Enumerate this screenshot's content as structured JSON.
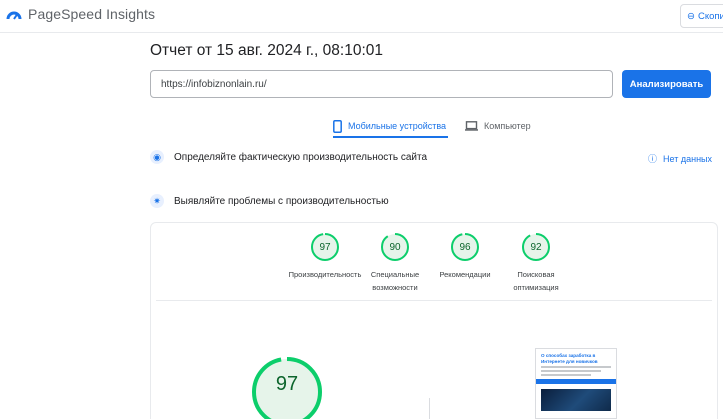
{
  "header": {
    "app_name": "PageSpeed Insights",
    "copy_label": "Скопи"
  },
  "report": {
    "title": "Отчет от 15 авг. 2024 г., 08:10:01",
    "url_value": "https://infobiznonlain.ru/",
    "analyze_label": "Анализировать"
  },
  "tabs": [
    {
      "label": "Мобильные устройства",
      "active": true
    },
    {
      "label": "Компьютер",
      "active": false
    }
  ],
  "sections": {
    "field": "Определяйте фактическую производительность сайта",
    "no_data": "Нет данных",
    "lab": "Выявляйте проблемы с производительностью"
  },
  "scores": [
    {
      "value": 97,
      "label_line1": "Производительность",
      "label_line2": ""
    },
    {
      "value": 90,
      "label_line1": "Специальные",
      "label_line2": "возможности"
    },
    {
      "value": 96,
      "label_line1": "Рекомендации",
      "label_line2": ""
    },
    {
      "value": 92,
      "label_line1": "Поисковая",
      "label_line2": "оптимизация"
    }
  ],
  "main_score": {
    "value": 97
  },
  "thumbnail": {
    "title": "О способах заработка в Интернете для новичков"
  },
  "colors": {
    "accent": "#1a73e8",
    "pass": "#0cce6b",
    "pass_text": "#0d652d",
    "pass_bg": "#e6f4ea"
  }
}
